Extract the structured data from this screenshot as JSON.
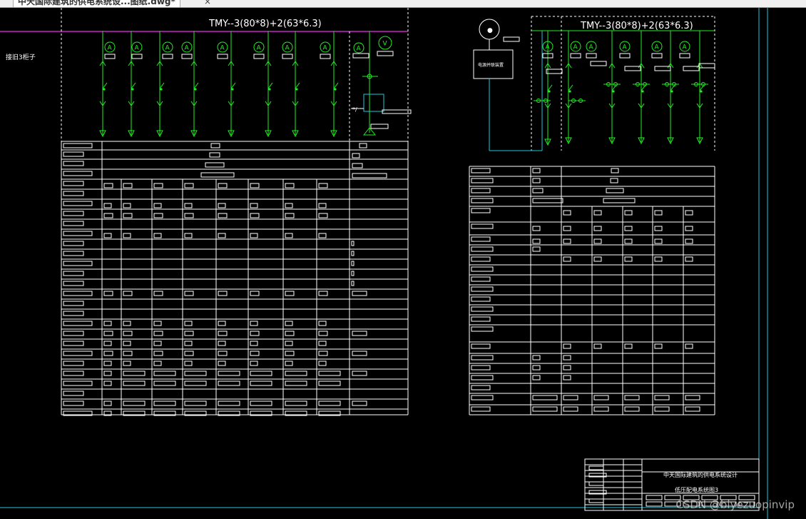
{
  "tab": {
    "title": "中天国际建筑的供电系统设...图纸.dwg*",
    "close": "×"
  },
  "left_diagram": {
    "busbar_label": "TMY--3(80*8)+2(63*6.3)",
    "side_label": "接旧3柜子",
    "ammeter_symbol": "A",
    "voltmeter_symbol": "V"
  },
  "right_diagram": {
    "busbar_label": "TMY--3(80*8)+2(63*6.3)",
    "device_box_label": "电源并联装置",
    "ammeter_symbol": "A"
  },
  "title_block": {
    "project_title": "中天国际建筑的供电系统设计",
    "drawing_title": "低压配电系统图3"
  },
  "watermark": "CSDN @biyezuopinvip",
  "colors": {
    "background": "#000000",
    "line": "#ffffff",
    "busbar": "#cc22cc",
    "circuit": "#22ee22",
    "border": "#22c8d8"
  }
}
